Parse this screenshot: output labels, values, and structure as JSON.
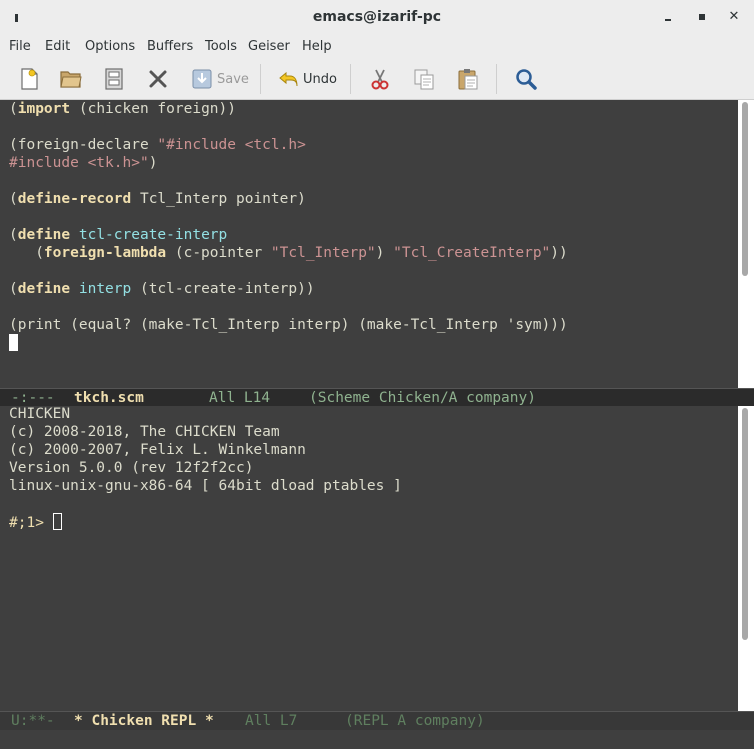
{
  "window": {
    "title": "emacs@izarif-pc"
  },
  "menubar": {
    "items": [
      "File",
      "Edit",
      "Options",
      "Buffers",
      "Tools",
      "Geiser",
      "Help"
    ]
  },
  "toolbar": {
    "new_file_icon": "new-file-icon",
    "open_icon": "folder-open-icon",
    "save_label": "Save",
    "undo_label": "Undo",
    "cut_icon": "scissors-icon",
    "copy_icon": "copy-icon",
    "paste_icon": "paste-icon",
    "search_icon": "search-icon"
  },
  "editor": {
    "lines": [
      [
        {
          "t": "(",
          "c": ""
        },
        {
          "t": "import",
          "c": "kw"
        },
        {
          "t": " (chicken foreign))",
          "c": ""
        }
      ],
      [],
      [
        {
          "t": "(foreign-declare ",
          "c": ""
        },
        {
          "t": "\"#include <tcl.h>",
          "c": "str"
        }
      ],
      [
        {
          "t": "#include <tk.h>\"",
          "c": "str"
        },
        {
          "t": ")",
          "c": ""
        }
      ],
      [],
      [
        {
          "t": "(",
          "c": ""
        },
        {
          "t": "define-record",
          "c": "kw"
        },
        {
          "t": " Tcl_Interp pointer)",
          "c": ""
        }
      ],
      [],
      [
        {
          "t": "(",
          "c": ""
        },
        {
          "t": "define",
          "c": "kw"
        },
        {
          "t": " ",
          "c": ""
        },
        {
          "t": "tcl-create-interp",
          "c": "fn"
        }
      ],
      [
        {
          "t": "   (",
          "c": ""
        },
        {
          "t": "foreign-lambda",
          "c": "kw"
        },
        {
          "t": " (c-pointer ",
          "c": ""
        },
        {
          "t": "\"Tcl_Interp\"",
          "c": "str"
        },
        {
          "t": ") ",
          "c": ""
        },
        {
          "t": "\"Tcl_CreateInterp\"",
          "c": "str"
        },
        {
          "t": "))",
          "c": ""
        }
      ],
      [],
      [
        {
          "t": "(",
          "c": ""
        },
        {
          "t": "define",
          "c": "kw"
        },
        {
          "t": " ",
          "c": ""
        },
        {
          "t": "interp",
          "c": "fn"
        },
        {
          "t": " (tcl-create-interp))",
          "c": ""
        }
      ],
      [],
      [
        {
          "t": "(print (equal? (make-Tcl_Interp interp) (make-Tcl_Interp 'sym)))",
          "c": ""
        }
      ]
    ]
  },
  "modeline1": {
    "status": "-:---",
    "buffer": "tkch.scm",
    "position": "All L14",
    "mode": "(Scheme Chicken/A company)"
  },
  "repl": {
    "lines": [
      "CHICKEN",
      "(c) 2008-2018, The CHICKEN Team",
      "(c) 2000-2007, Felix L. Winkelmann",
      "Version 5.0.0 (rev 12f2f2cc)",
      "linux-unix-gnu-x86-64 [ 64bit dload ptables ]",
      ""
    ],
    "prompt": "#;1>"
  },
  "modeline2": {
    "status": "U:**-",
    "buffer": "* Chicken REPL *",
    "position": "All L7",
    "mode": "(REPL A company)"
  }
}
